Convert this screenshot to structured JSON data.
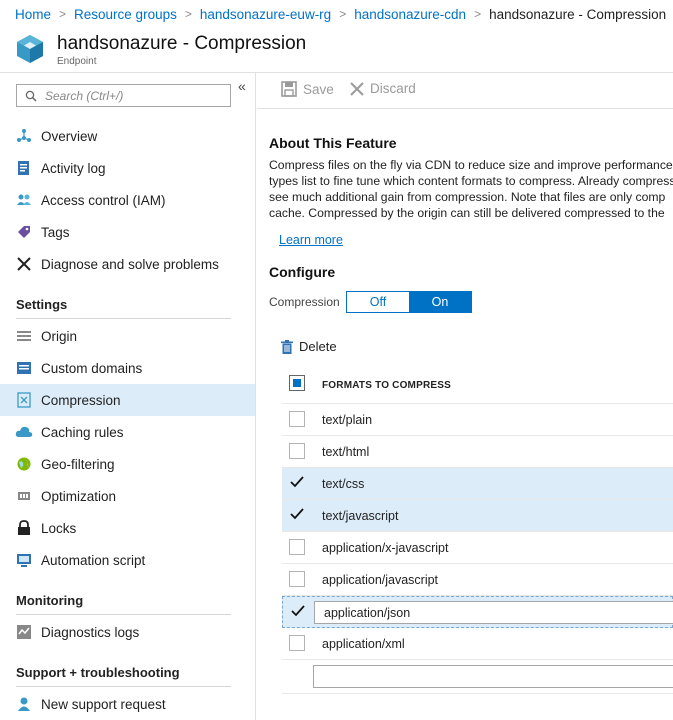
{
  "breadcrumb": {
    "items": [
      "Home",
      "Resource groups",
      "handsonazure-euw-rg",
      "handsonazure-cdn"
    ],
    "current": "handsonazure - Compression"
  },
  "header": {
    "title": "handsonazure - Compression",
    "subtitle": "Endpoint"
  },
  "sidebar": {
    "search_placeholder": "Search (Ctrl+/)",
    "collapse_glyph": "«",
    "items_top": [
      {
        "label": "Overview",
        "icon": "overview-icon"
      },
      {
        "label": "Activity log",
        "icon": "activity-log-icon"
      },
      {
        "label": "Access control (IAM)",
        "icon": "iam-icon"
      },
      {
        "label": "Tags",
        "icon": "tag-icon"
      },
      {
        "label": "Diagnose and solve problems",
        "icon": "wrench-icon"
      }
    ],
    "settings_header": "Settings",
    "settings_items": [
      {
        "label": "Origin",
        "icon": "origin-icon"
      },
      {
        "label": "Custom domains",
        "icon": "custom-domains-icon"
      },
      {
        "label": "Compression",
        "icon": "compression-icon",
        "active": true
      },
      {
        "label": "Caching rules",
        "icon": "cloud-icon"
      },
      {
        "label": "Geo-filtering",
        "icon": "globe-icon"
      },
      {
        "label": "Optimization",
        "icon": "optimization-icon"
      },
      {
        "label": "Locks",
        "icon": "lock-icon"
      },
      {
        "label": "Automation script",
        "icon": "script-icon"
      }
    ],
    "monitoring_header": "Monitoring",
    "monitoring_items": [
      {
        "label": "Diagnostics logs",
        "icon": "diagnostics-icon"
      }
    ],
    "support_header": "Support + troubleshooting",
    "support_items": [
      {
        "label": "New support request",
        "icon": "support-icon"
      }
    ]
  },
  "toolbar": {
    "save_label": "Save",
    "discard_label": "Discard"
  },
  "about": {
    "heading": "About This Feature",
    "lines": [
      "Compress files on the fly via CDN to reduce size and improve performance",
      "types list to fine tune which content formats to compress. Already compress",
      "see much additional gain from compression. Note that files are only comp",
      "cache. Compressed by the origin can still be delivered compressed to the"
    ],
    "learn_more": "Learn more"
  },
  "configure": {
    "heading": "Configure",
    "compression_label": "Compression",
    "toggle_off": "Off",
    "toggle_on": "On",
    "compression_enabled": true
  },
  "formats": {
    "delete_label": "Delete",
    "column_header": "FORMATS TO COMPRESS",
    "rows": [
      {
        "value": "text/plain",
        "checked": false
      },
      {
        "value": "text/html",
        "checked": false
      },
      {
        "value": "text/css",
        "checked": true
      },
      {
        "value": "text/javascript",
        "checked": true
      },
      {
        "value": "application/x-javascript",
        "checked": false
      },
      {
        "value": "application/javascript",
        "checked": false
      },
      {
        "value": "application/json",
        "checked": true,
        "editing": true
      },
      {
        "value": "application/xml",
        "checked": false
      }
    ],
    "new_value": ""
  },
  "colors": {
    "accent": "#0072c6",
    "selected_row": "#ddecf9"
  }
}
